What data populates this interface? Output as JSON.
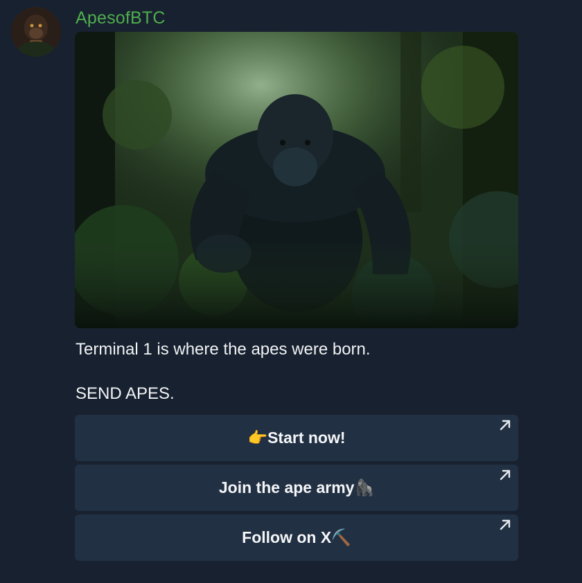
{
  "message": {
    "sender": "ApesofBTC",
    "avatar_icon": "ape-avatar-icon",
    "photo_alt": "ape-in-jungle-photo",
    "lines": [
      "Terminal 1 is where the apes were born.",
      "SEND APES."
    ]
  },
  "buttons": [
    {
      "pre": "👉 ",
      "label": "Start now!",
      "post": "",
      "icon": "external-link-arrow-icon"
    },
    {
      "pre": "",
      "label": "Join the ape army",
      "post": " 🦍",
      "icon": "external-link-arrow-icon"
    },
    {
      "pre": "",
      "label": "Follow on X",
      "post": " ⛏️",
      "icon": "external-link-arrow-icon"
    }
  ],
  "colors": {
    "background": "#18212f",
    "sender_name": "#4fae4e",
    "button_bg": "#223043",
    "text": "#f1f3f6"
  }
}
